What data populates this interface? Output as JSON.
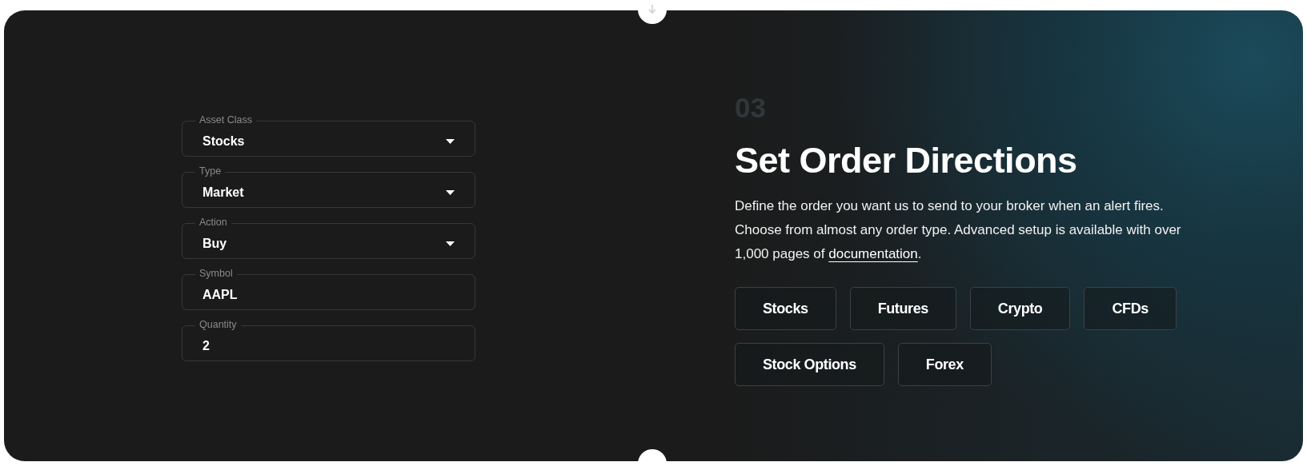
{
  "form": {
    "fields": [
      {
        "kind": "dropdown",
        "label": "Asset Class",
        "value": "Stocks"
      },
      {
        "kind": "dropdown",
        "label": "Type",
        "value": "Market"
      },
      {
        "kind": "dropdown",
        "label": "Action",
        "value": "Buy"
      },
      {
        "kind": "text",
        "label": "Symbol",
        "value": "AAPL"
      },
      {
        "kind": "text",
        "label": "Quantity",
        "value": "2"
      }
    ]
  },
  "step": {
    "number": "03",
    "title": "Set Order Directions",
    "description": "Define the order you want us to send to your broker when an alert fires. Choose from almost any order type. Advanced setup is available with over 1,000 pages of ",
    "link": "documentation",
    "description_end": "."
  },
  "asset_buttons": [
    {
      "label": "Stocks"
    },
    {
      "label": "Futures"
    },
    {
      "label": "Crypto"
    },
    {
      "label": "CFDs"
    },
    {
      "label": "Stock Options"
    },
    {
      "label": "Forex"
    }
  ]
}
